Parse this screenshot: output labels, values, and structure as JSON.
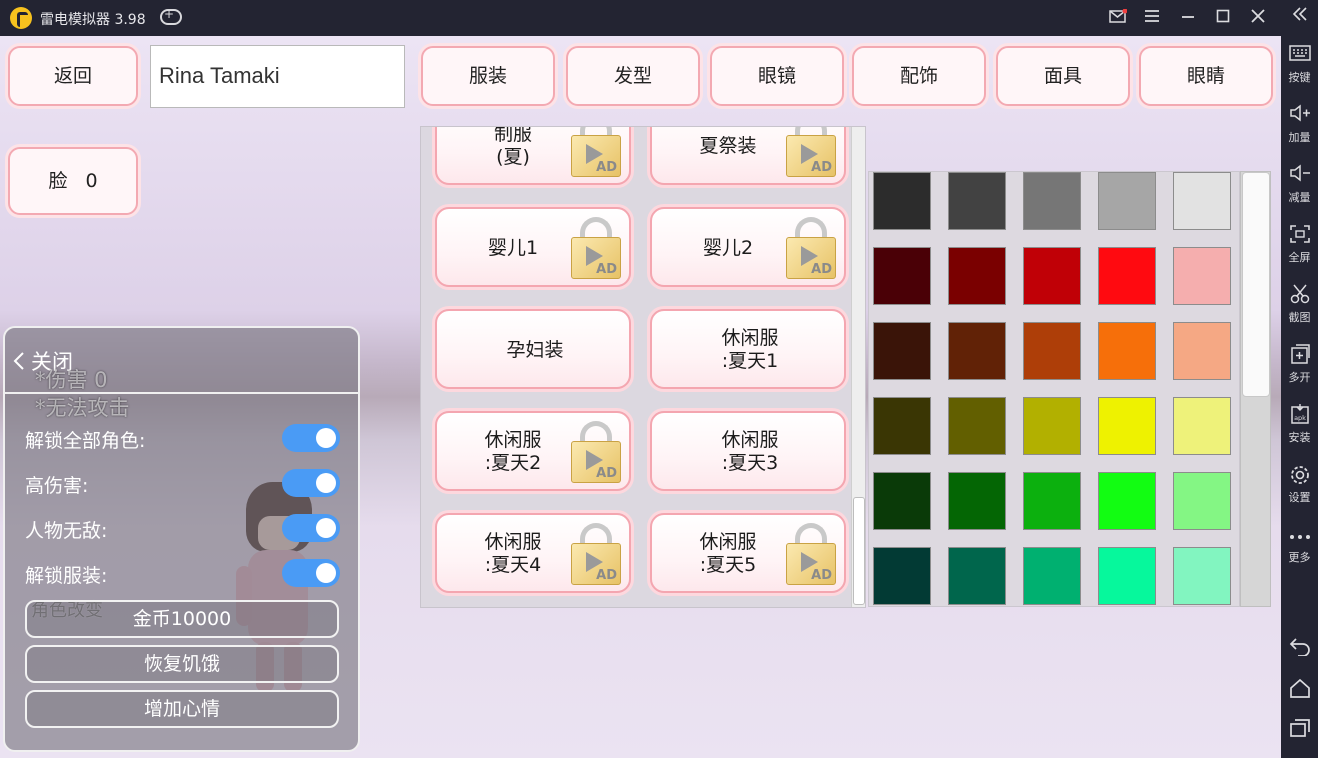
{
  "window": {
    "title": "雷电模拟器 3.98",
    "icons": [
      "logo-icon",
      "gamepad-icon",
      "mail-icon",
      "menu-icon",
      "minimize-icon",
      "maximize-icon",
      "close-icon"
    ]
  },
  "sidebar": {
    "items": [
      {
        "label": "按键",
        "icon": "keyboard-icon"
      },
      {
        "label": "加量",
        "icon": "volume-up-icon"
      },
      {
        "label": "减量",
        "icon": "volume-down-icon"
      },
      {
        "label": "全屏",
        "icon": "fullscreen-icon"
      },
      {
        "label": "截图",
        "icon": "scissors-icon"
      },
      {
        "label": "多开",
        "icon": "multi-instance-icon"
      },
      {
        "label": "安装",
        "icon": "apk-icon"
      },
      {
        "label": "设置",
        "icon": "gear-icon"
      },
      {
        "label": "更多",
        "icon": "more-icon"
      }
    ]
  },
  "game": {
    "back_label": "返回",
    "name_value": "Rina Tamaki",
    "tabs": [
      "服装",
      "发型",
      "眼镜",
      "配饰",
      "面具",
      "眼睛"
    ],
    "face_label": "脸",
    "face_value": "0",
    "outfits": [
      {
        "line1": "制服",
        "line2": "(夏)",
        "locked": true
      },
      {
        "line1": "夏祭装",
        "line2": "",
        "locked": true
      },
      {
        "line1": "婴儿1",
        "line2": "",
        "locked": true
      },
      {
        "line1": "婴儿2",
        "line2": "",
        "locked": true
      },
      {
        "line1": "孕妇装",
        "line2": "",
        "locked": false
      },
      {
        "line1": "休闲服",
        "line2": ":夏天1",
        "locked": false
      },
      {
        "line1": "休闲服",
        "line2": ":夏天2",
        "locked": true
      },
      {
        "line1": "休闲服",
        "line2": ":夏天3",
        "locked": false
      },
      {
        "line1": "休闲服",
        "line2": ":夏天4",
        "locked": true
      },
      {
        "line1": "休闲服",
        "line2": ":夏天5",
        "locked": true
      }
    ],
    "ad_label": "AD",
    "palette": [
      [
        "#2c2c2c",
        "#424242",
        "#767676",
        "#a6a6a6",
        "#e2e2e2"
      ],
      [
        "#4a0006",
        "#7a0000",
        "#c00006",
        "#ff0a10",
        "#f5aeae"
      ],
      [
        "#3a1408",
        "#612206",
        "#ae3e08",
        "#f66f0a",
        "#f5a884"
      ],
      [
        "#3a3604",
        "#625f00",
        "#b2b000",
        "#eef200",
        "#eef27a"
      ],
      [
        "#0a3a08",
        "#046604",
        "#0cb00e",
        "#12fd12",
        "#84f684"
      ],
      [
        "#023a34",
        "#00664c",
        "#00b070",
        "#06f89c",
        "#82f5c0"
      ]
    ]
  },
  "mod_menu": {
    "close_label": "关闭",
    "ghost_damage": "*伤害 0",
    "ghost_no_attack": "*无法攻击",
    "ghost_role_change": "角色改变",
    "toggles": [
      {
        "label": "解锁全部角色:",
        "on": true
      },
      {
        "label": "高伤害:",
        "on": true
      },
      {
        "label": "人物无敌:",
        "on": true
      },
      {
        "label": "解锁服装:",
        "on": true
      }
    ],
    "buttons": [
      "金币10000",
      "恢复饥饿",
      "增加心情"
    ],
    "toggle_color": "#4a9bf5"
  }
}
